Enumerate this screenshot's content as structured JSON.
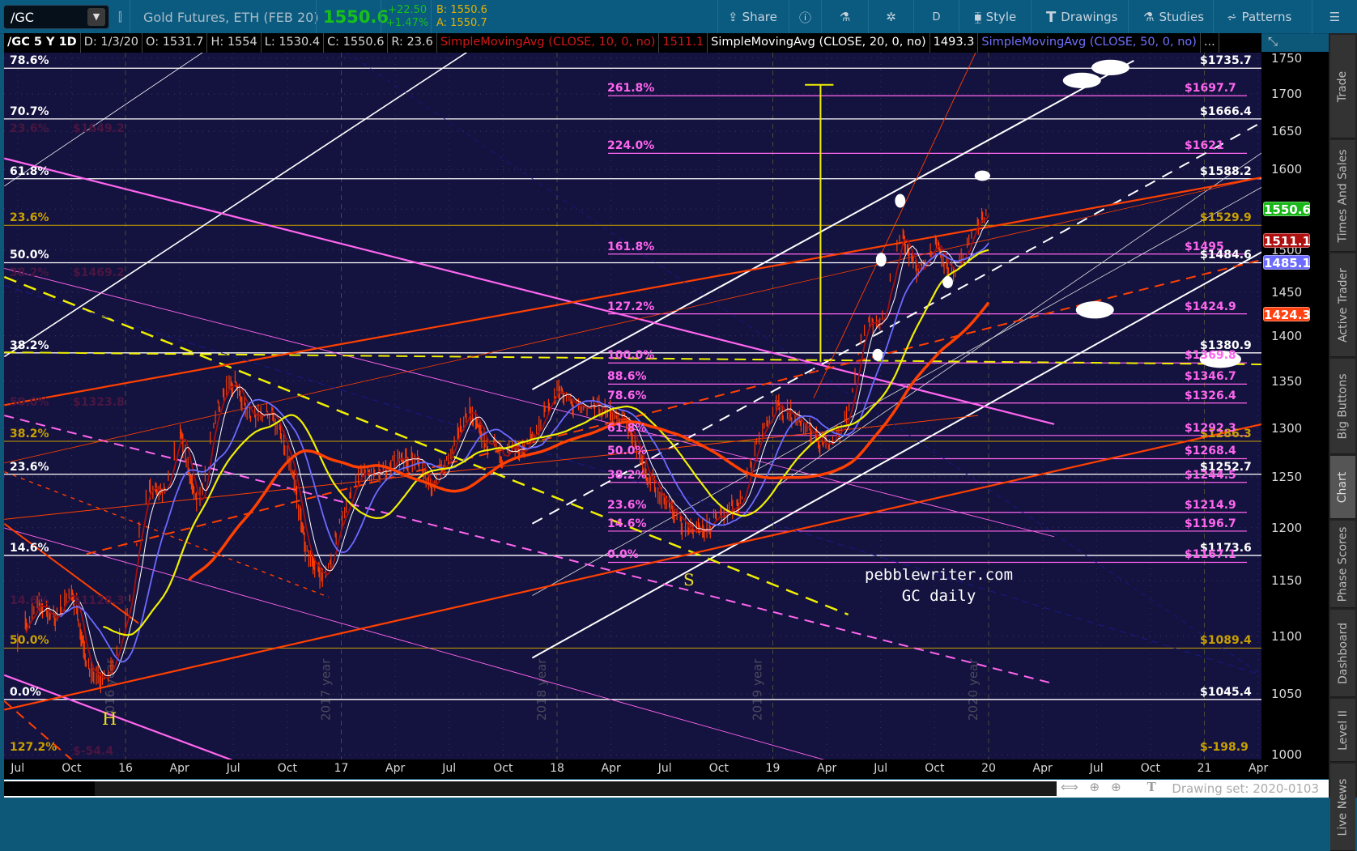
{
  "toolbar": {
    "symbol": "/GC",
    "description": "Gold Futures, ETH (FEB 20)",
    "last": "1550.6",
    "change": "+22.50",
    "change_pct": "+1.47%",
    "bid": "B: 1550.6",
    "ask": "A: 1550.7",
    "share": "Share",
    "style": "Style",
    "drawings": "Drawings",
    "studies": "Studies",
    "patterns": "Patterns",
    "aggregation": "D"
  },
  "infobar": {
    "symbol_period": "/GC 5 Y 1D",
    "date": "D: 1/3/20",
    "open": "O: 1531.7",
    "high": "H: 1554",
    "low": "L: 1530.4",
    "close": "C: 1550.6",
    "range": "R: 23.6",
    "sma10_label": "SimpleMovingAvg (CLOSE, 10, 0, no)",
    "sma10_value": "1511.1",
    "sma20_label": "SimpleMovingAvg (CLOSE, 20, 0, no)",
    "sma20_value": "1493.3",
    "sma50_label": "SimpleMovingAvg (CLOSE, 50, 0, no)",
    "more": "..."
  },
  "chart_data": {
    "type": "line",
    "title": "/GC 5 Y 1D",
    "scale": "log",
    "ylim": [
      1000,
      1750
    ],
    "y_ticks": [
      "1750",
      "1700",
      "1650",
      "1600",
      "1550",
      "1500",
      "1450",
      "1400",
      "1350",
      "1300",
      "1250",
      "1200",
      "1150",
      "1100",
      "1050",
      "1000"
    ],
    "x_ticks": [
      {
        "label": "Jul",
        "t": 2015.5
      },
      {
        "label": "Oct",
        "t": 2015.75
      },
      {
        "label": "16",
        "t": 2016
      },
      {
        "label": "Apr",
        "t": 2016.25
      },
      {
        "label": "Jul",
        "t": 2016.5
      },
      {
        "label": "Oct",
        "t": 2016.75
      },
      {
        "label": "17",
        "t": 2017
      },
      {
        "label": "Apr",
        "t": 2017.25
      },
      {
        "label": "Jul",
        "t": 2017.5
      },
      {
        "label": "Oct",
        "t": 2017.75
      },
      {
        "label": "18",
        "t": 2018
      },
      {
        "label": "Apr",
        "t": 2018.25
      },
      {
        "label": "Jul",
        "t": 2018.5
      },
      {
        "label": "Oct",
        "t": 2018.75
      },
      {
        "label": "19",
        "t": 2019
      },
      {
        "label": "Apr",
        "t": 2019.25
      },
      {
        "label": "Jul",
        "t": 2019.5
      },
      {
        "label": "Oct",
        "t": 2019.75
      },
      {
        "label": "20",
        "t": 2020
      },
      {
        "label": "Apr",
        "t": 2020.25
      },
      {
        "label": "Jul",
        "t": 2020.5
      },
      {
        "label": "Oct",
        "t": 2020.75
      },
      {
        "label": "21",
        "t": 2021
      },
      {
        "label": "Apr",
        "t": 2021.25
      }
    ],
    "year_marks": [
      {
        "label": "2016 year",
        "t": 2016
      },
      {
        "label": "2017 year",
        "t": 2017
      },
      {
        "label": "2018 year",
        "t": 2018
      },
      {
        "label": "2019 year",
        "t": 2019
      },
      {
        "label": "2020 year",
        "t": 2020
      }
    ],
    "monthly_close": {
      "start": 2015.5,
      "values": [
        1095,
        1130,
        1115,
        1142,
        1065,
        1062,
        1118,
        1236,
        1233,
        1292,
        1216,
        1322,
        1352,
        1310,
        1317,
        1272,
        1175,
        1152,
        1212,
        1252,
        1250,
        1268,
        1270,
        1242,
        1272,
        1322,
        1282,
        1272,
        1276,
        1305,
        1343,
        1318,
        1325,
        1316,
        1300,
        1252,
        1224,
        1202,
        1192,
        1215,
        1222,
        1282,
        1321,
        1316,
        1294,
        1284,
        1306,
        1412,
        1415,
        1520,
        1470,
        1512,
        1465,
        1520,
        1550.6
      ]
    },
    "sma_series": [
      {
        "name": "SMA 10",
        "period": 10,
        "color": "#a31010",
        "last": "1511.1"
      },
      {
        "name": "SMA 20",
        "period": 20,
        "color": "#ffffff",
        "last": "1493.3"
      },
      {
        "name": "SMA 50",
        "period": 50,
        "color": "#6b6bff",
        "last": "1485.1"
      },
      {
        "name": "SMA 100",
        "period": 100,
        "color": "#f0f000"
      },
      {
        "name": "SMA 200",
        "period": 200,
        "color": "#ff4000",
        "last": "1424.3"
      }
    ],
    "price_tags": [
      {
        "value": "1550.6",
        "price": 1550.6,
        "color": "#18b818"
      },
      {
        "value": "1511.1",
        "price": 1511.1,
        "color": "#b01010"
      },
      {
        "value": "1485.1",
        "price": 1485.1,
        "color": "#6b6bff"
      },
      {
        "value": "1424.3",
        "price": 1424.3,
        "color": "#ff4010"
      }
    ],
    "fib_left": [
      {
        "pct": "78.6%",
        "price": 1735.7,
        "value": "$1735.7",
        "color": "#ffffff"
      },
      {
        "pct": "70.7%",
        "price": 1666.4,
        "value": "$1666.4",
        "color": "#ffffff"
      },
      {
        "pct": "61.8%",
        "price": 1588.2,
        "value": "$1588.2",
        "color": "#ffffff"
      },
      {
        "pct": "50.0%",
        "price": 1484.6,
        "value": "$1484.6",
        "color": "#ffffff"
      },
      {
        "pct": "38.2%",
        "price": 1380.9,
        "value": "$1380.9",
        "color": "#ffffff"
      },
      {
        "pct": "23.6%",
        "price": 1252.7,
        "value": "$1252.7",
        "color": "#ffffff"
      },
      {
        "pct": "14.6%",
        "price": 1173.6,
        "value": "$1173.6",
        "color": "#ffffff"
      },
      {
        "pct": "0.0%",
        "price": 1045.4,
        "value": "$1045.4",
        "color": "#ffffff"
      }
    ],
    "fib_gold": [
      {
        "pct": "23.6%",
        "price": 1529.9,
        "value": "$1529.9",
        "color": "#c8a000"
      },
      {
        "pct": "38.2%",
        "price": 1286.3,
        "value": "$1286.3",
        "color": "#c8a000"
      },
      {
        "pct": "50.0%",
        "price": 1089.4,
        "value": "$1089.4",
        "color": "#c8a000"
      },
      {
        "pct": "127.2%",
        "price": -198.9,
        "value": "$-198.9",
        "color": "#c8a000"
      }
    ],
    "fib_magenta": [
      {
        "pct": "261.8%",
        "price": 1697.7,
        "value": "$1697.7"
      },
      {
        "pct": "224.0%",
        "price": 1621,
        "value": "$1621"
      },
      {
        "pct": "161.8%",
        "price": 1495,
        "value": "$1495"
      },
      {
        "pct": "127.2%",
        "price": 1424.9,
        "value": "$1424.9"
      },
      {
        "pct": "100.0%",
        "price": 1369.8,
        "value": "$1369.8"
      },
      {
        "pct": "88.6%",
        "price": 1346.7,
        "value": "$1346.7"
      },
      {
        "pct": "78.6%",
        "price": 1326.4,
        "value": "$1326.4"
      },
      {
        "pct": "61.8%",
        "price": 1292.3,
        "value": "$1292.3"
      },
      {
        "pct": "50.0%",
        "price": 1268.4,
        "value": "$1268.4"
      },
      {
        "pct": "38.2%",
        "price": 1244.5,
        "value": "$1244.5"
      },
      {
        "pct": "23.6%",
        "price": 1214.9,
        "value": "$1214.9"
      },
      {
        "pct": "14.6%",
        "price": 1196.7,
        "value": "$1196.7"
      },
      {
        "pct": "0.0%",
        "price": 1167.1,
        "value": "$1167.1"
      }
    ],
    "fib_faded": [
      {
        "pct": "23.6%",
        "price": 1649.2,
        "value": "$1649.2"
      },
      {
        "pct": "38.2%",
        "price": 1469.2,
        "value": "$1469.2"
      },
      {
        "pct": "50.0%",
        "price": 1323.8,
        "value": "$1323.8"
      },
      {
        "pct": "14.6%",
        "price": 1128.3,
        "value": "$1128.3"
      },
      {
        "pct": "",
        "price": 1000,
        "value": "$-54.4"
      }
    ],
    "annotations": {
      "watermark1": "pebblewriter.com",
      "watermark2": "GC daily",
      "head": "H",
      "shoulder": "S"
    }
  },
  "bottom": {
    "drawing_set": "Drawing set: 2020-0103"
  },
  "sidetabs": [
    "Trade",
    "Times And Sales",
    "Active Trader",
    "Big Buttons",
    "Chart",
    "Phase Scores",
    "Dashboard",
    "Level II",
    "Live News"
  ],
  "colors": {
    "chart_bg": "#14123f",
    "toolbar_bg": "#0b5a80",
    "up": "#19c019",
    "down": "#ff3c00"
  }
}
